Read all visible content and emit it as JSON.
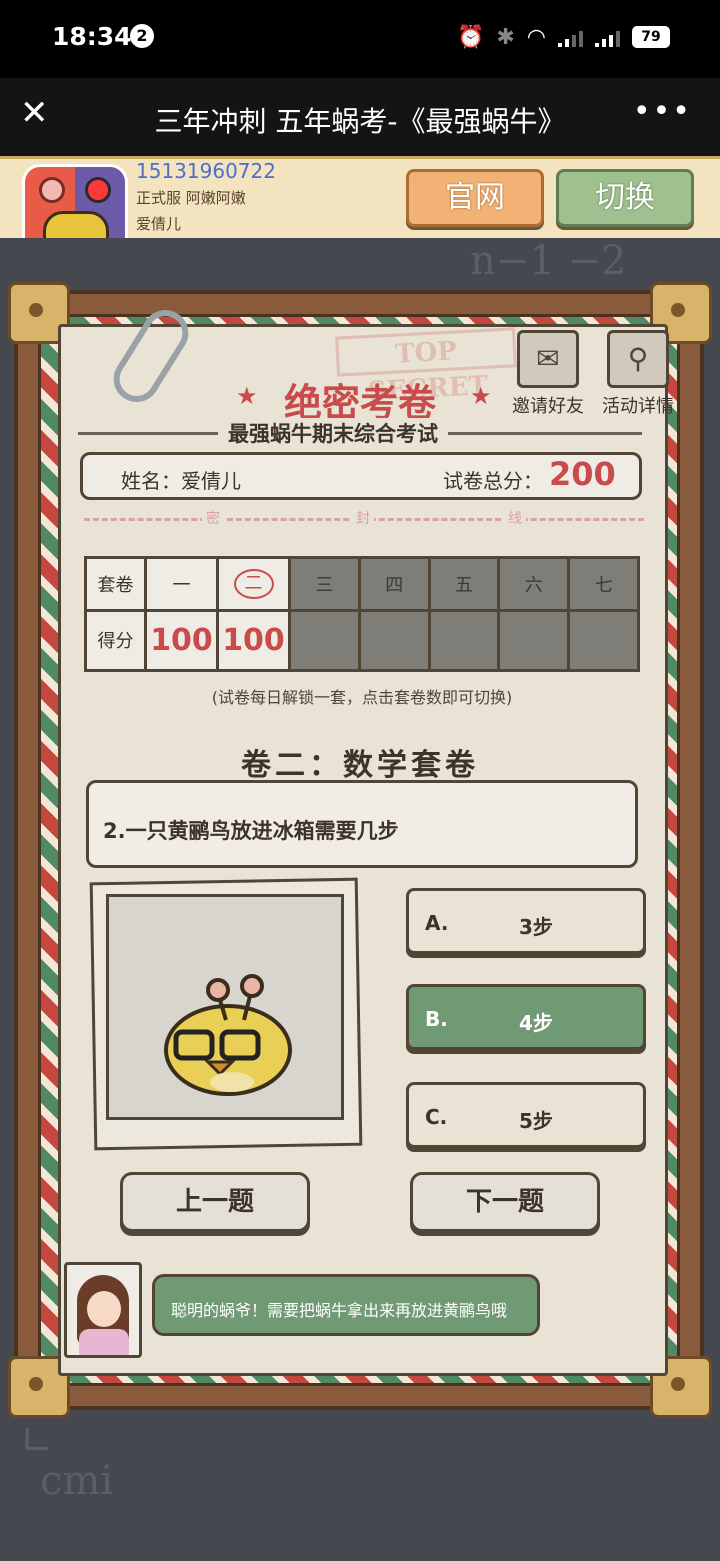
{
  "status_bar": {
    "time": "18:34",
    "notification_count": "2",
    "battery": "79"
  },
  "title_bar": {
    "title": "三年冲刺 五年蜗考-《最强蜗牛》"
  },
  "account": {
    "phone": "15131960722",
    "server": "正式服 阿嫩阿嫩",
    "name": "爱倩儿",
    "official_btn": "官网",
    "switch_btn": "切换"
  },
  "paper": {
    "stamp": "TOP SECRET",
    "title": "绝密考卷",
    "subtitle": "最强蜗牛期末综合考试",
    "invite_label": "邀请好友",
    "detail_label": "活动详情",
    "name_label": "姓名：爱倩儿",
    "score_label": "试卷总分：",
    "total_score": "200",
    "seal_chars": [
      "密",
      "封",
      "线"
    ],
    "suite_header": "套卷",
    "score_header": "得分",
    "suites": [
      "一",
      "二",
      "三",
      "四",
      "五",
      "六",
      "七"
    ],
    "scores": [
      "100",
      "100",
      "",
      "",
      "",
      "",
      ""
    ],
    "hint": "(试卷每日解锁一套，点击套卷数即可切换)",
    "section_title": "卷二：数学套卷",
    "question": "2.一只黄鹂鸟放进冰箱需要几步",
    "options": [
      {
        "key": "A.",
        "value": "3步"
      },
      {
        "key": "B.",
        "value": "4步"
      },
      {
        "key": "C.",
        "value": "5步"
      }
    ],
    "selected_option": "B.",
    "prev_btn": "上一题",
    "next_btn": "下一题",
    "tip": "聪明的蜗爷！需要把蜗牛拿出来再放进黄鹂鸟哦"
  },
  "colors": {
    "accent_red": "#c94b4b",
    "selected_green": "#6f9a73"
  }
}
